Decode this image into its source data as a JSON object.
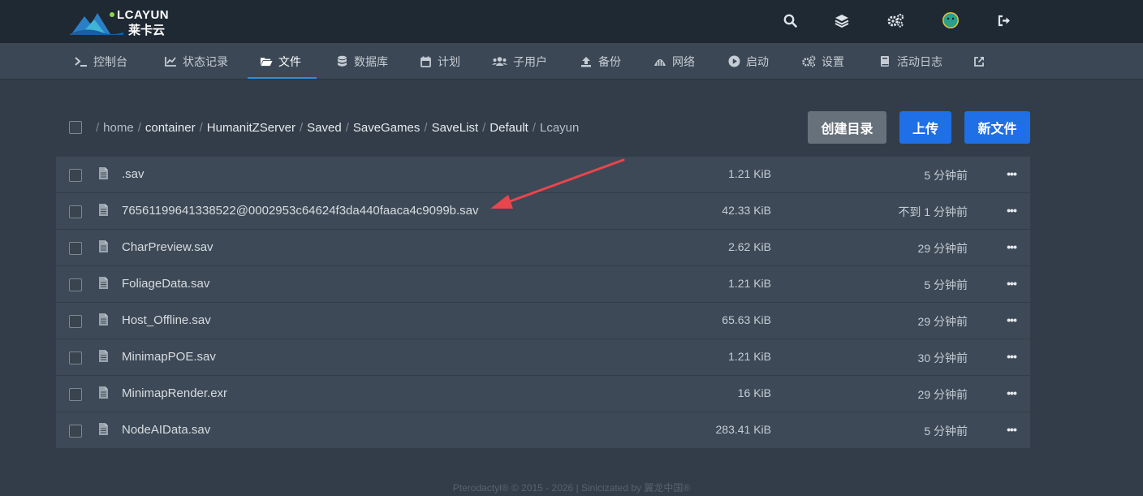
{
  "brand": {
    "name_en": "LCAYUN",
    "name_cn": "莱卡云"
  },
  "top_icons": [
    "search-icon",
    "layers-icon",
    "cogs-icon",
    "avatar",
    "sign-out-icon"
  ],
  "nav": {
    "items": [
      {
        "label": "控制台",
        "icon": "terminal-icon"
      },
      {
        "label": "状态记录",
        "icon": "chart-icon"
      },
      {
        "label": "文件",
        "icon": "folder-open-icon"
      },
      {
        "label": "数据库",
        "icon": "database-icon"
      },
      {
        "label": "计划",
        "icon": "calendar-icon"
      },
      {
        "label": "子用户",
        "icon": "users-icon"
      },
      {
        "label": "备份",
        "icon": "upload-icon"
      },
      {
        "label": "网络",
        "icon": "network-icon"
      },
      {
        "label": "启动",
        "icon": "play-circle-icon"
      },
      {
        "label": "设置",
        "icon": "cogs-icon"
      },
      {
        "label": "活动日志",
        "icon": "book-icon"
      },
      {
        "label": "",
        "icon": "external-link-icon"
      }
    ],
    "active": "文件"
  },
  "breadcrumb": {
    "items": [
      "home",
      "container",
      "HumanitZServer",
      "Saved",
      "SaveGames",
      "SaveList",
      "Default",
      "Lcayun"
    ]
  },
  "actions": {
    "create_dir": "创建目录",
    "upload": "上传",
    "new_file": "新文件"
  },
  "files": [
    {
      "name": ".sav",
      "size": "1.21 KiB",
      "modified": "5 分钟前"
    },
    {
      "name": "76561199641338522@0002953c64624f3da440faaca4c9099b.sav",
      "size": "42.33 KiB",
      "modified": "不到 1 分钟前"
    },
    {
      "name": "CharPreview.sav",
      "size": "2.62 KiB",
      "modified": "29 分钟前"
    },
    {
      "name": "FoliageData.sav",
      "size": "1.21 KiB",
      "modified": "5 分钟前"
    },
    {
      "name": "Host_Offline.sav",
      "size": "65.63 KiB",
      "modified": "29 分钟前"
    },
    {
      "name": "MinimapPOE.sav",
      "size": "1.21 KiB",
      "modified": "30 分钟前"
    },
    {
      "name": "MinimapRender.exr",
      "size": "16 KiB",
      "modified": "29 分钟前"
    },
    {
      "name": "NodeAIData.sav",
      "size": "283.41 KiB",
      "modified": "5 分钟前"
    }
  ],
  "row_menu": "•••",
  "footer": "Pterodactyl® © 2015 - 2026 | Sinicizated by 翼龙中国®",
  "colors": {
    "accent_blue": "#1f6fe6",
    "annotation_arrow": "#e8454d"
  }
}
